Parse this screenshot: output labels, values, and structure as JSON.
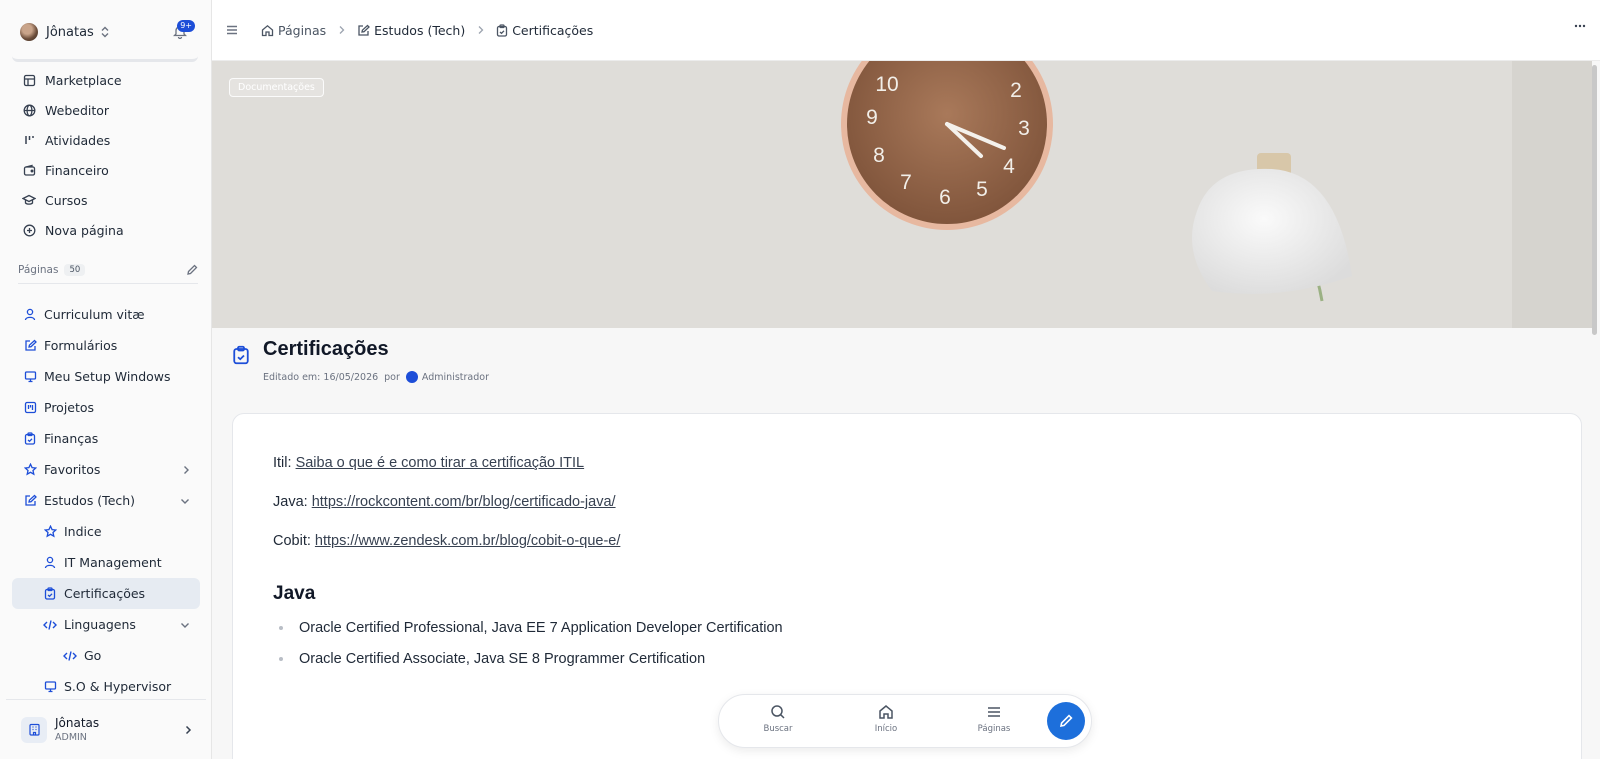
{
  "sidebar": {
    "user_name": "Jônatas",
    "notif_badge": "9+",
    "nav": [
      {
        "label": "Marketplace",
        "icon": "store-icon"
      },
      {
        "label": "Webeditor",
        "icon": "globe-icon"
      },
      {
        "label": "Atividades",
        "icon": "activity-icon"
      },
      {
        "label": "Financeiro",
        "icon": "wallet-icon"
      },
      {
        "label": "Cursos",
        "icon": "graduation-cap-icon"
      },
      {
        "label": "Nova página",
        "icon": "plus-circle-icon"
      }
    ],
    "pages_label": "Páginas",
    "pages_count": "50",
    "tree": [
      {
        "label": "Curriculum vitæ",
        "icon": "user-icon"
      },
      {
        "label": "Formulários",
        "icon": "edit-icon"
      },
      {
        "label": "Meu Setup Windows",
        "icon": "monitor-icon"
      },
      {
        "label": "Projetos",
        "icon": "kanban-icon"
      },
      {
        "label": "Finanças",
        "icon": "clipboard-icon"
      },
      {
        "label": "Favoritos",
        "icon": "star-icon"
      },
      {
        "label": "Estudos (Tech)",
        "icon": "edit-icon"
      },
      {
        "label": "Indice",
        "icon": "star-icon"
      },
      {
        "label": "IT Management",
        "icon": "user-icon"
      },
      {
        "label": "Certificações",
        "icon": "clipboard-check-icon"
      },
      {
        "label": "Linguagens",
        "icon": "code-icon"
      },
      {
        "label": "Go",
        "icon": "code-icon"
      },
      {
        "label": "S.O & Hypervisor",
        "icon": "monitor-icon"
      }
    ],
    "footer": {
      "name": "Jônatas",
      "role": "ADMIN"
    }
  },
  "header": {
    "breadcrumbs": [
      "Páginas",
      "Estudos (Tech)",
      "Certificações"
    ]
  },
  "page": {
    "cover_tag": "Documentações",
    "title": "Certificações",
    "edited_label": "Editado em: 16/05/2026",
    "by_label": "por",
    "author": "Administrador",
    "content": {
      "itil_label": "Itil:",
      "itil_link": "Saiba o que é e como tirar a certificação ITIL",
      "java_label": "Java:",
      "java_link": "https://rockcontent.com/br/blog/certificado-java/",
      "cobit_label": "Cobit:",
      "cobit_link": "https://www.zendesk.com.br/blog/cobit-o-que-e/",
      "heading_java": "Java",
      "bullets": [
        "Oracle Certified Professional, Java EE 7 Application Developer Certification",
        "Oracle Certified Associate, Java SE 8 Programmer Certification"
      ]
    }
  },
  "toolbar": {
    "search": "Buscar",
    "home": "Início",
    "pages": "Páginas"
  },
  "colors": {
    "accent": "#1d4ed8",
    "active_bg": "#e6ebf2",
    "fab": "#1d6fdb"
  }
}
